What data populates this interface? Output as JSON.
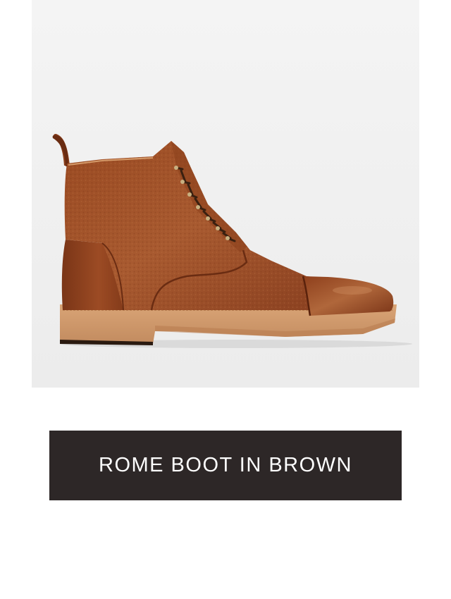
{
  "product": {
    "image_alt": "Rome Boot in Brown",
    "name": "ROME BOOT IN BROWN"
  },
  "colors": {
    "button_bg": "#2d2727",
    "button_text": "#ffffff",
    "photo_bg": "#f1f1f1"
  },
  "icons": {
    "product_image": "brown-lace-up-boot"
  }
}
